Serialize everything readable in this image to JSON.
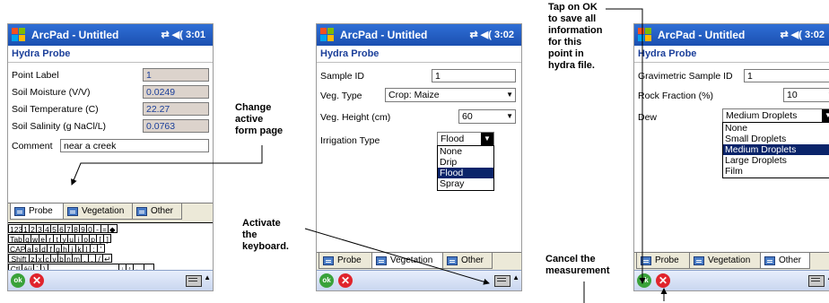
{
  "app": {
    "title": "ArcPad - Untitled",
    "form_title": "Hydra Probe"
  },
  "screens": [
    {
      "time": "3:01",
      "fields": [
        {
          "label": "Point Label",
          "value": "1"
        },
        {
          "label": "Soil Moisture (V/V)",
          "value": "0.0249"
        },
        {
          "label": "Soil Temperature (C)",
          "value": "22.27"
        },
        {
          "label": "Soil Salinity (g NaCl/L)",
          "value": "0.0763"
        }
      ],
      "comment": {
        "label": "Comment",
        "value": "near a creek"
      }
    },
    {
      "time": "3:02",
      "sample_id": {
        "label": "Sample ID",
        "value": "1"
      },
      "veg_type": {
        "label": "Veg. Type",
        "value": "Crop: Maize"
      },
      "veg_height": {
        "label": "Veg. Height (cm)",
        "value": "60"
      },
      "irrigation": {
        "label": "Irrigation Type",
        "value": "Flood",
        "options": [
          "None",
          "Drip",
          "Flood",
          "Spray"
        ]
      }
    },
    {
      "time": "3:02",
      "grav_id": {
        "label": "Gravimetric Sample ID",
        "value": "1"
      },
      "rock": {
        "label": "Rock Fraction (%)",
        "value": "10"
      },
      "dew": {
        "label": "Dew",
        "value": "Medium Droplets",
        "options": [
          "None",
          "Small Droplets",
          "Medium Droplets",
          "Large Droplets",
          "Film"
        ]
      }
    }
  ],
  "tabs": [
    "Probe",
    "Vegetation",
    "Other"
  ],
  "keyboard": {
    "row1": [
      "123",
      "1",
      "2",
      "3",
      "4",
      "5",
      "6",
      "7",
      "8",
      "9",
      "0",
      "-",
      "=",
      "◆"
    ],
    "row2": [
      "Tab",
      "q",
      "w",
      "e",
      "r",
      "t",
      "y",
      "u",
      "i",
      "o",
      "p",
      "[",
      "]"
    ],
    "row3": [
      "CAP",
      "a",
      "s",
      "d",
      "f",
      "g",
      "h",
      "j",
      "k",
      "l",
      ";",
      "'"
    ],
    "row4": [
      "Shift",
      "z",
      "x",
      "c",
      "v",
      "b",
      "n",
      "m",
      ",",
      ".",
      "/",
      "↵"
    ],
    "row5": [
      "Ctl",
      "áü",
      "`",
      "\\",
      "",
      "↓",
      "↑",
      "←",
      "→"
    ]
  },
  "buttons": {
    "ok": "ok",
    "cancel": "✕"
  },
  "annotations": {
    "change_form": "Change\nactive\nform page",
    "activate_kbd": "Activate\nthe\nkeyboard.",
    "tap_ok": "Tap on OK\nto save all\ninformation\nfor this\npoint in\nhydra file.",
    "cancel": "Cancel the\nmeasurement"
  }
}
